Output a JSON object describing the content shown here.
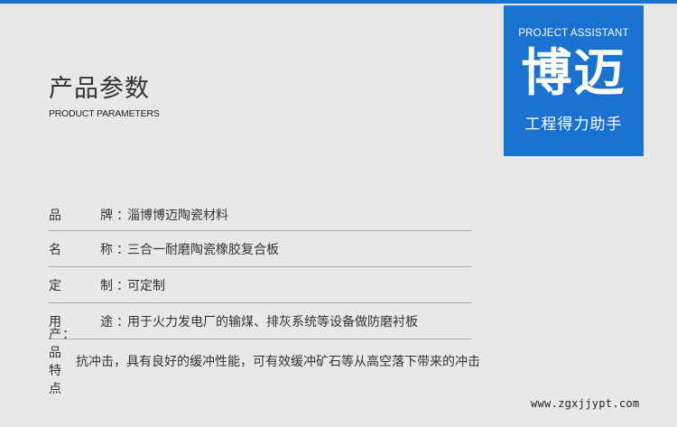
{
  "header": {
    "title_cn": "产品参数",
    "title_en": "PRODUCT PARAMETERS"
  },
  "logo": {
    "english": "PROJECT ASSISTANT",
    "brand": "博迈",
    "tagline": "工程得力助手"
  },
  "specs": [
    {
      "label_a": "品",
      "label_b": "牌",
      "value": "淄博博迈陶瓷材料"
    },
    {
      "label_a": "名",
      "label_b": "称",
      "value": "三合一耐磨陶瓷橡胶复合板"
    },
    {
      "label_a": "定",
      "label_b": "制",
      "value": "可定制"
    },
    {
      "label_a": "用",
      "label_b": "途",
      "value": "用于火力发电厂的输煤、排灰系统等设备做防磨衬板"
    }
  ],
  "feature": {
    "label": "产品特点",
    "value": "抗冲击，具有良好的缓冲性能，可有效缓冲矿石等从高空落下带来的冲击"
  },
  "colon": "：",
  "website": "www.zgxjjypt.com",
  "colors": {
    "brand_blue": "#1a72d0",
    "background": "#e8e8e8"
  }
}
